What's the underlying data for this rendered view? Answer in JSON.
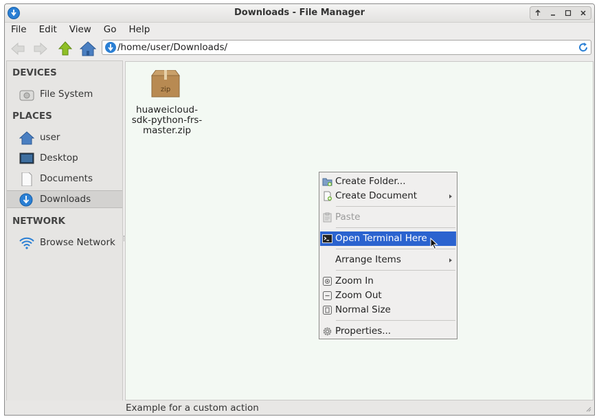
{
  "window": {
    "title": "Downloads - File Manager"
  },
  "menubar": {
    "items": [
      "File",
      "Edit",
      "View",
      "Go",
      "Help"
    ]
  },
  "toolbar": {
    "path": "/home/user/Downloads/"
  },
  "sidebar": {
    "devices_heading": "DEVICES",
    "places_heading": "PLACES",
    "network_heading": "NETWORK",
    "devices": [
      {
        "label": "File System",
        "icon": "drive-icon"
      }
    ],
    "places": [
      {
        "label": "user",
        "icon": "home-icon"
      },
      {
        "label": "Desktop",
        "icon": "desktop-icon"
      },
      {
        "label": "Documents",
        "icon": "document-icon"
      },
      {
        "label": "Downloads",
        "icon": "downloads-icon",
        "selected": true
      }
    ],
    "network": [
      {
        "label": "Browse Network",
        "icon": "wifi-icon"
      }
    ]
  },
  "content": {
    "file": {
      "icon_text": "zip",
      "name_line1": "huaweicloud-",
      "name_line2": "sdk-python-frs-",
      "name_line3": "master.zip"
    }
  },
  "context_menu": {
    "create_folder": "Create Folder...",
    "create_document": "Create Document",
    "paste": "Paste",
    "open_terminal": "Open Terminal Here",
    "arrange_items": "Arrange Items",
    "zoom_in": "Zoom In",
    "zoom_out": "Zoom Out",
    "normal_size": "Normal Size",
    "properties": "Properties..."
  },
  "statusbar": {
    "text": "Example for a custom action"
  },
  "colors": {
    "accent": "#2b63cf",
    "content_bg": "#f3f9f3",
    "chrome": "#edeceb"
  }
}
